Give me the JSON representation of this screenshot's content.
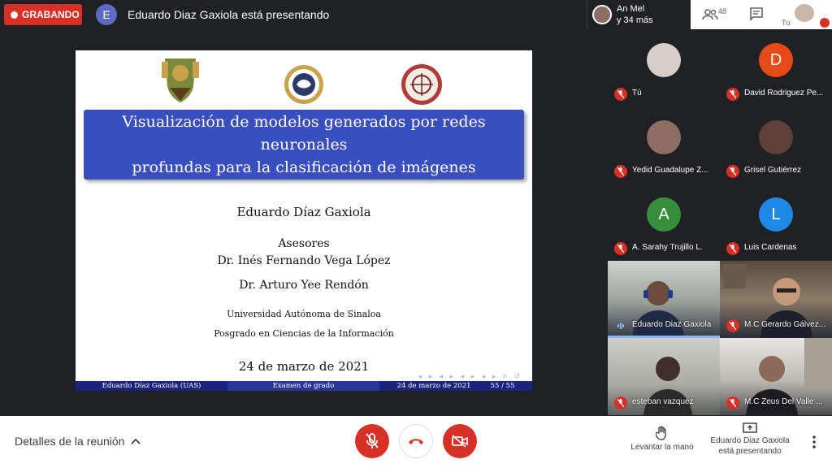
{
  "topbar": {
    "recording_label": "GRABANDO",
    "presenter_initial": "E",
    "presenting_text": "Eduardo Diaz Gaxiola está presentando",
    "summary_line1": "An Mel",
    "summary_line2": "y 34 más",
    "participant_count": "48",
    "self_label": "Tú"
  },
  "slide": {
    "title_line1": "Visualización de modelos generados por redes neuronales",
    "title_line2": "profundas para la clasificación de imágenes",
    "author": "Eduardo Díaz Gaxiola",
    "advisors_heading": "Asesores",
    "advisor1": "Dr. Inés Fernando Vega López",
    "advisor2": "Dr. Arturo Yee Rendón",
    "university": "Universidad Autónoma de Sinaloa",
    "program": "Posgrado en Ciencias de la Información",
    "date": "24 de marzo de 2021",
    "footer_author": "Eduardo Díaz Gaxiola  (UAS)",
    "footer_event": "Examen de grado",
    "footer_date": "24 de marzo de 2021",
    "footer_page": "55 / 55"
  },
  "participants": [
    {
      "name": "Tú",
      "initial": "",
      "color": "#d7ccc8"
    },
    {
      "name": "David Rodriguez Pe...",
      "initial": "D",
      "color": "#e64a19"
    },
    {
      "name": "Yedid Guadalupe Z...",
      "initial": "",
      "color": "#8d6e63"
    },
    {
      "name": "Grisel Gutiérrez",
      "initial": "",
      "color": "#5d4037"
    },
    {
      "name": "A. Sarahy Trujillo L.",
      "initial": "A",
      "color": "#388e3c"
    },
    {
      "name": "Luis Cardenas",
      "initial": "L",
      "color": "#1e88e5"
    }
  ],
  "video_tiles": [
    {
      "name": "Eduardo Diaz Gaxiola"
    },
    {
      "name": "M.C Gerardo Gálvez..."
    },
    {
      "name": "esteban vazquez"
    },
    {
      "name": "M.C Zeus Del Valle ..."
    }
  ],
  "bottombar": {
    "details_label": "Detalles de la reunión",
    "raise_hand_label": "Levantar la mano",
    "presenting_line1": "Eduardo Diaz Gaxiola",
    "presenting_line2": "está presentando"
  },
  "colors": {
    "record_red": "#d93025",
    "slide_title_blue": "#3a4fbf",
    "footer_navy": "#1a237e"
  }
}
